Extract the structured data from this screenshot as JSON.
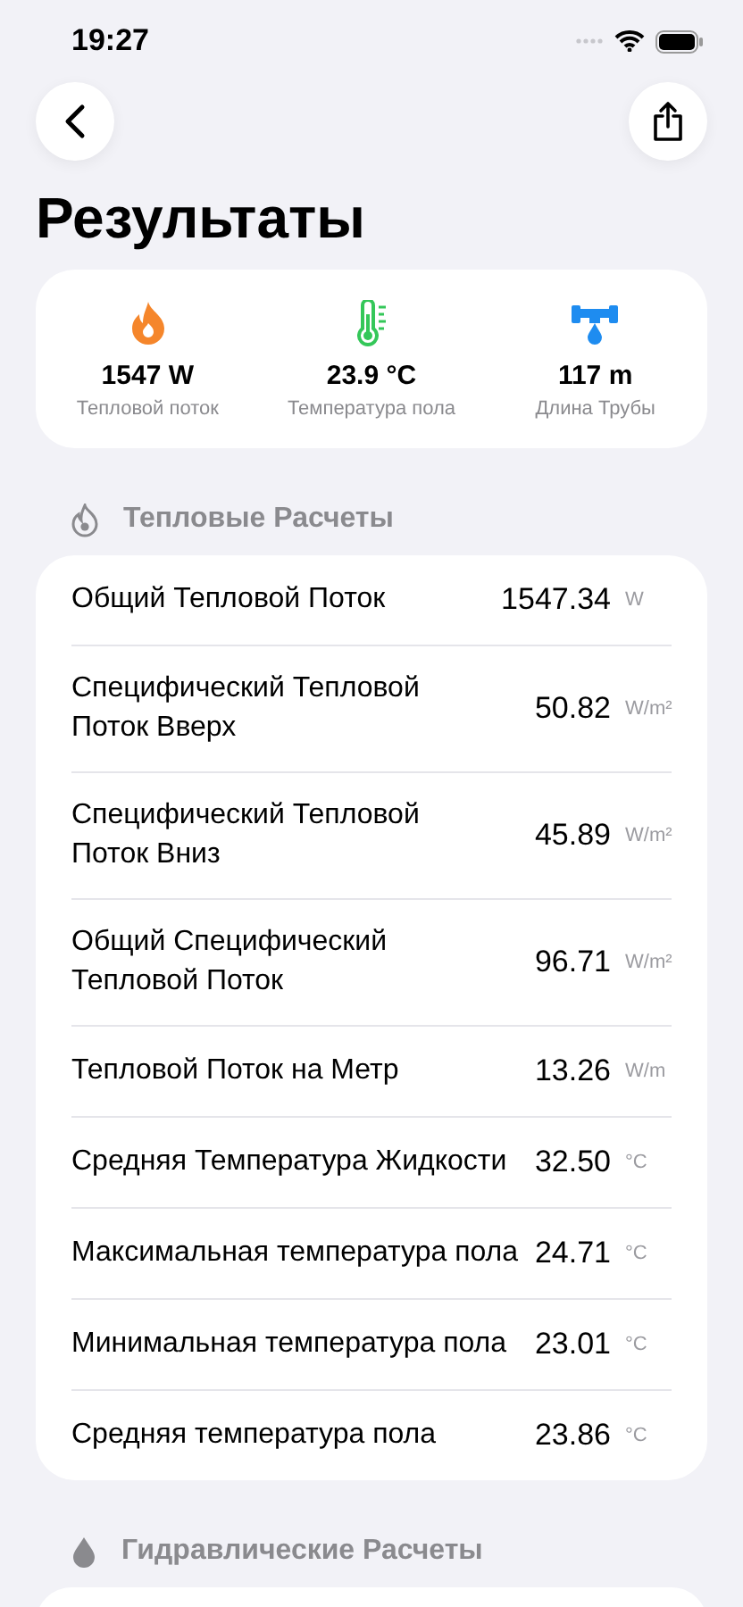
{
  "status_bar": {
    "time": "19:27"
  },
  "title": "Результаты",
  "summary": [
    {
      "kind": "flame",
      "value": "1547 W",
      "label": "Тепловой поток",
      "color": "#f5862b"
    },
    {
      "kind": "thermometer",
      "value": "23.9 °C",
      "label": "Температура пола",
      "color": "#34c759"
    },
    {
      "kind": "pipe",
      "value": "117 m",
      "label": "Длина Трубы",
      "color": "#1e8cf0"
    }
  ],
  "sections": [
    {
      "kind": "flame",
      "title": "Тепловые Расчеты",
      "rows": [
        {
          "label": "Общий Тепловой Поток",
          "value": "1547.34",
          "unit": "W"
        },
        {
          "label": "Специфический Тепловой Поток Вверх",
          "value": "50.82",
          "unit": "W/m²"
        },
        {
          "label": "Специфический Тепловой Поток Вниз",
          "value": "45.89",
          "unit": "W/m²"
        },
        {
          "label": "Общий Специфический Тепловой Поток",
          "value": "96.71",
          "unit": "W/m²"
        },
        {
          "label": "Тепловой Поток на Метр",
          "value": "13.26",
          "unit": "W/m"
        },
        {
          "label": "Средняя Температура Жидкости",
          "value": "32.50",
          "unit": "°C"
        },
        {
          "label": "Максимальная температура пола",
          "value": "24.71",
          "unit": "°C"
        },
        {
          "label": "Минимальная температура пола",
          "value": "23.01",
          "unit": "°C"
        },
        {
          "label": "Средняя температура пола",
          "value": "23.86",
          "unit": "°C"
        }
      ]
    },
    {
      "kind": "drop",
      "title": "Гидравлические Расчеты"
    }
  ]
}
